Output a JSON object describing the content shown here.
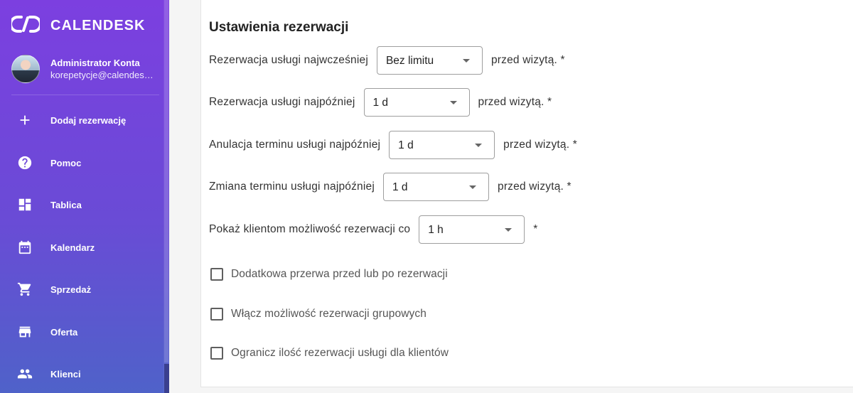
{
  "sidebar": {
    "brand": "CALENDESK",
    "profile": {
      "name": "Administrator Konta",
      "email": "korepetycje@calendesk.net"
    },
    "items": [
      {
        "label": "Dodaj rezerwację",
        "icon": "plus-icon"
      },
      {
        "label": "Pomoc",
        "icon": "help-icon"
      },
      {
        "label": "Tablica",
        "icon": "dashboard-icon"
      },
      {
        "label": "Kalendarz",
        "icon": "calendar-icon"
      },
      {
        "label": "Sprzedaż",
        "icon": "cart-icon"
      },
      {
        "label": "Oferta",
        "icon": "store-icon"
      },
      {
        "label": "Klienci",
        "icon": "people-icon"
      }
    ]
  },
  "settings": {
    "title": "Ustawienia rezerwacji",
    "rows": [
      {
        "label": "Rezerwacja usługi najwcześniej",
        "value": "Bez limitu",
        "suffix": "przed wizytą. *"
      },
      {
        "label": "Rezerwacja usługi najpóźniej",
        "value": "1 d",
        "suffix": "przed wizytą. *"
      },
      {
        "label": "Anulacja terminu usługi najpóźniej",
        "value": "1 d",
        "suffix": "przed wizytą. *"
      },
      {
        "label": "Zmiana terminu usługi najpóźniej",
        "value": "1 d",
        "suffix": "przed wizytą. *"
      },
      {
        "label": "Pokaż klientom możliwość rezerwacji co",
        "value": "1 h",
        "suffix": "*"
      }
    ],
    "checkboxes": [
      {
        "label": "Dodatkowa przerwa przed lub po rezerwacji",
        "checked": false
      },
      {
        "label": "Włącz możliwość rezerwacji grupowych",
        "checked": false
      },
      {
        "label": "Ogranicz ilość rezerwacji usługi dla klientów",
        "checked": false
      }
    ]
  }
}
